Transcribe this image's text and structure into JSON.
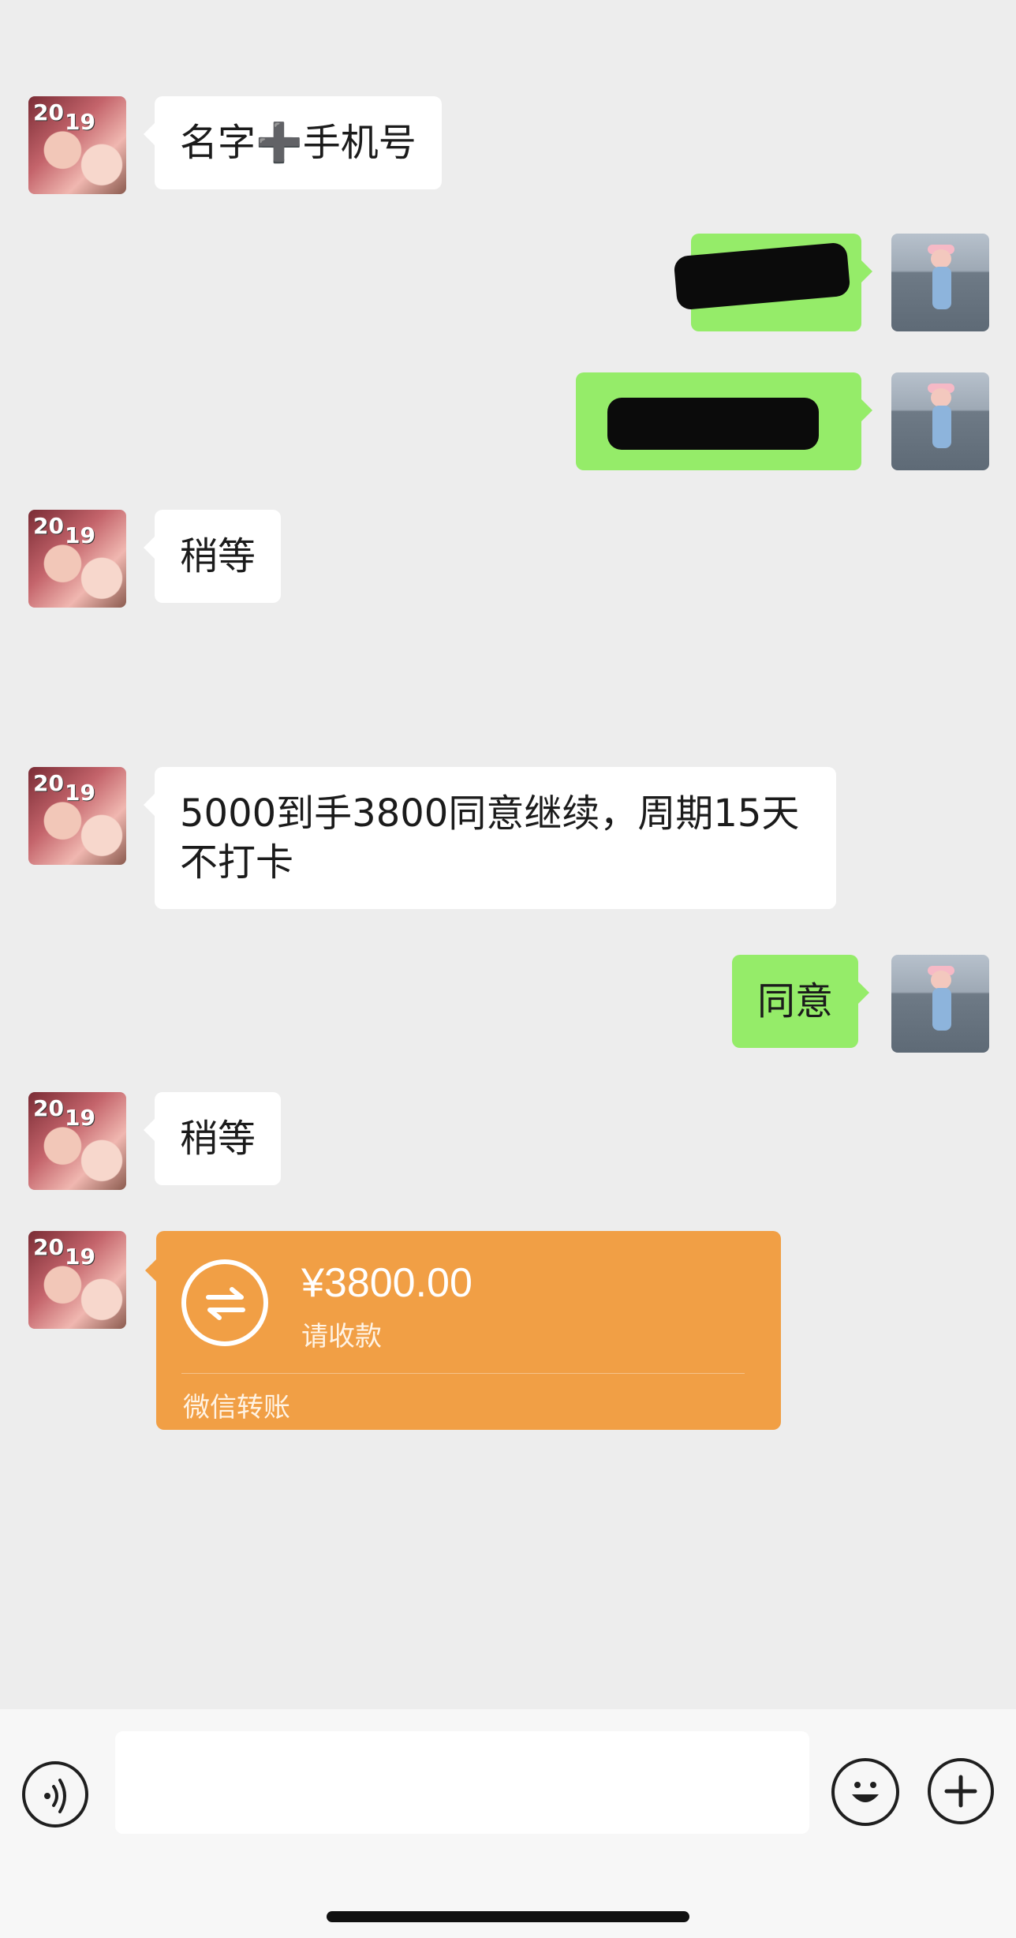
{
  "messages": [
    {
      "side": "left",
      "text": "名字➕手机号"
    },
    {
      "side": "right",
      "text": "",
      "redacted": true
    },
    {
      "side": "right",
      "text": "",
      "redacted": true
    },
    {
      "side": "left",
      "text": "稍等"
    },
    {
      "side": "left",
      "text": "5000到手3800同意继续，周期15天不打卡"
    },
    {
      "side": "right",
      "text": "同意"
    },
    {
      "side": "left",
      "text": "稍等"
    }
  ],
  "transfer": {
    "amount": "¥3800.00",
    "status": "请收款",
    "brand": "微信转账"
  },
  "input_bar": {
    "placeholder": "",
    "icons": [
      "voice-icon",
      "emoji-icon",
      "plus-icon"
    ]
  },
  "colors": {
    "background": "#ededed",
    "incoming_bubble": "#ffffff",
    "outgoing_bubble": "#95ec69",
    "transfer_card": "#f19f45"
  }
}
